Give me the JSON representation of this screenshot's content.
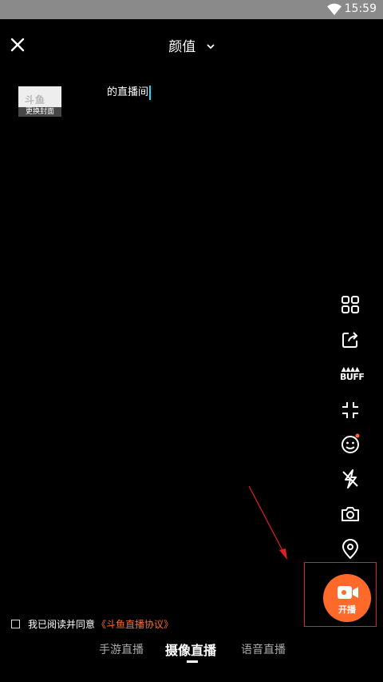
{
  "status_bar": {
    "time": "15:59",
    "wifi_icon": "wifi-icon"
  },
  "header": {
    "category": "颜值",
    "close_icon": "close-icon",
    "dropdown_icon": "chevron-down-icon"
  },
  "cover": {
    "logo_text": "斗鱼",
    "change_label": "更换封面"
  },
  "room": {
    "title": "的直播间"
  },
  "side_tools": [
    {
      "name": "grid-icon"
    },
    {
      "name": "share-icon"
    },
    {
      "name": "buff-icon",
      "label": "BUFF"
    },
    {
      "name": "shrink-icon"
    },
    {
      "name": "beauty-face-icon",
      "badge": true
    },
    {
      "name": "flash-off-icon"
    },
    {
      "name": "flip-camera-icon"
    },
    {
      "name": "location-icon"
    }
  ],
  "live_button": {
    "label": "开播",
    "icon": "video-camera-icon"
  },
  "agreement": {
    "prefix": "我已阅读并同意",
    "link": "《斗鱼直播协议》"
  },
  "mode_tabs": [
    {
      "label": "手游直播",
      "active": false
    },
    {
      "label": "摄像直播",
      "active": true
    },
    {
      "label": "语音直播",
      "active": false
    }
  ],
  "colors": {
    "accent": "#ff6a2a",
    "annotation_red": "#e02020",
    "cursor": "#00e5ff"
  }
}
